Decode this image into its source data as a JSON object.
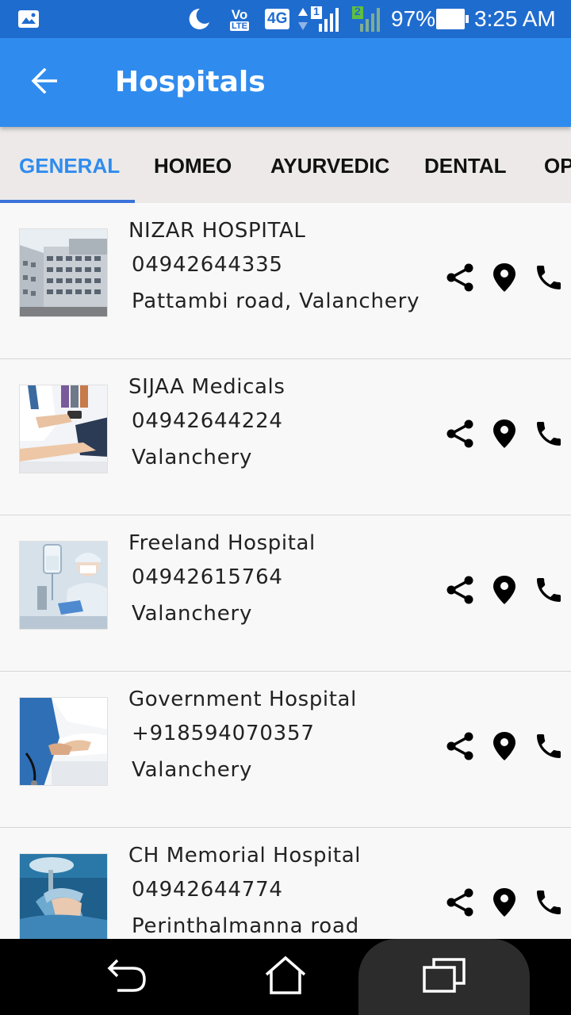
{
  "status_bar": {
    "battery": "97%",
    "time": "3:25 AM",
    "network_4g": "4G",
    "volte_top": "Vo",
    "volte_bottom": "LTE",
    "sim1": "1",
    "sim2": "2",
    "icons": [
      "image-icon",
      "moon-icon",
      "volte-icon",
      "4g-icon",
      "signal-sim1-icon",
      "signal-sim2-icon",
      "battery-icon"
    ]
  },
  "app_bar": {
    "title": "Hospitals",
    "back_icon": "arrow-left-icon"
  },
  "tabs": [
    {
      "label": "GENERAL",
      "active": true
    },
    {
      "label": "HOMEO",
      "active": false
    },
    {
      "label": "AYURVEDIC",
      "active": false
    },
    {
      "label": "DENTAL",
      "active": false
    },
    {
      "label": "OP",
      "active": false
    }
  ],
  "hospitals": [
    {
      "name": "NIZAR HOSPITAL",
      "phone": "04942644335",
      "address": "Pattambi road, Valanchery",
      "image": "hospital-building"
    },
    {
      "name": "SIJAA Medicals",
      "phone": "04942644224",
      "address": "Valanchery",
      "image": "doctor-checkup"
    },
    {
      "name": "Freeland Hospital",
      "phone": "04942615764",
      "address": "Valanchery",
      "image": "nurse-iv-drip"
    },
    {
      "name": "Government Hospital",
      "phone": "+918594070357",
      "address": "Valanchery",
      "image": "nurse-patient-hands"
    },
    {
      "name": "CH Memorial Hospital",
      "phone": "04942644774",
      "address": "Perinthalmanna road",
      "image": "patient-surgery"
    }
  ],
  "row_actions": [
    "share-icon",
    "map-pin-icon",
    "phone-icon"
  ],
  "colors": {
    "status_bar": "#1f6ccf",
    "app_bar": "#2f8cee",
    "tab_bar": "#ece9e8",
    "active_tab": "#2f8cee",
    "indicator": "#3b73d9",
    "list_bg": "#f8f8f9",
    "nav_bar": "#000000"
  },
  "nav_bar": {
    "buttons": [
      "nav-back-icon",
      "nav-home-icon",
      "nav-recents-icon"
    ]
  }
}
